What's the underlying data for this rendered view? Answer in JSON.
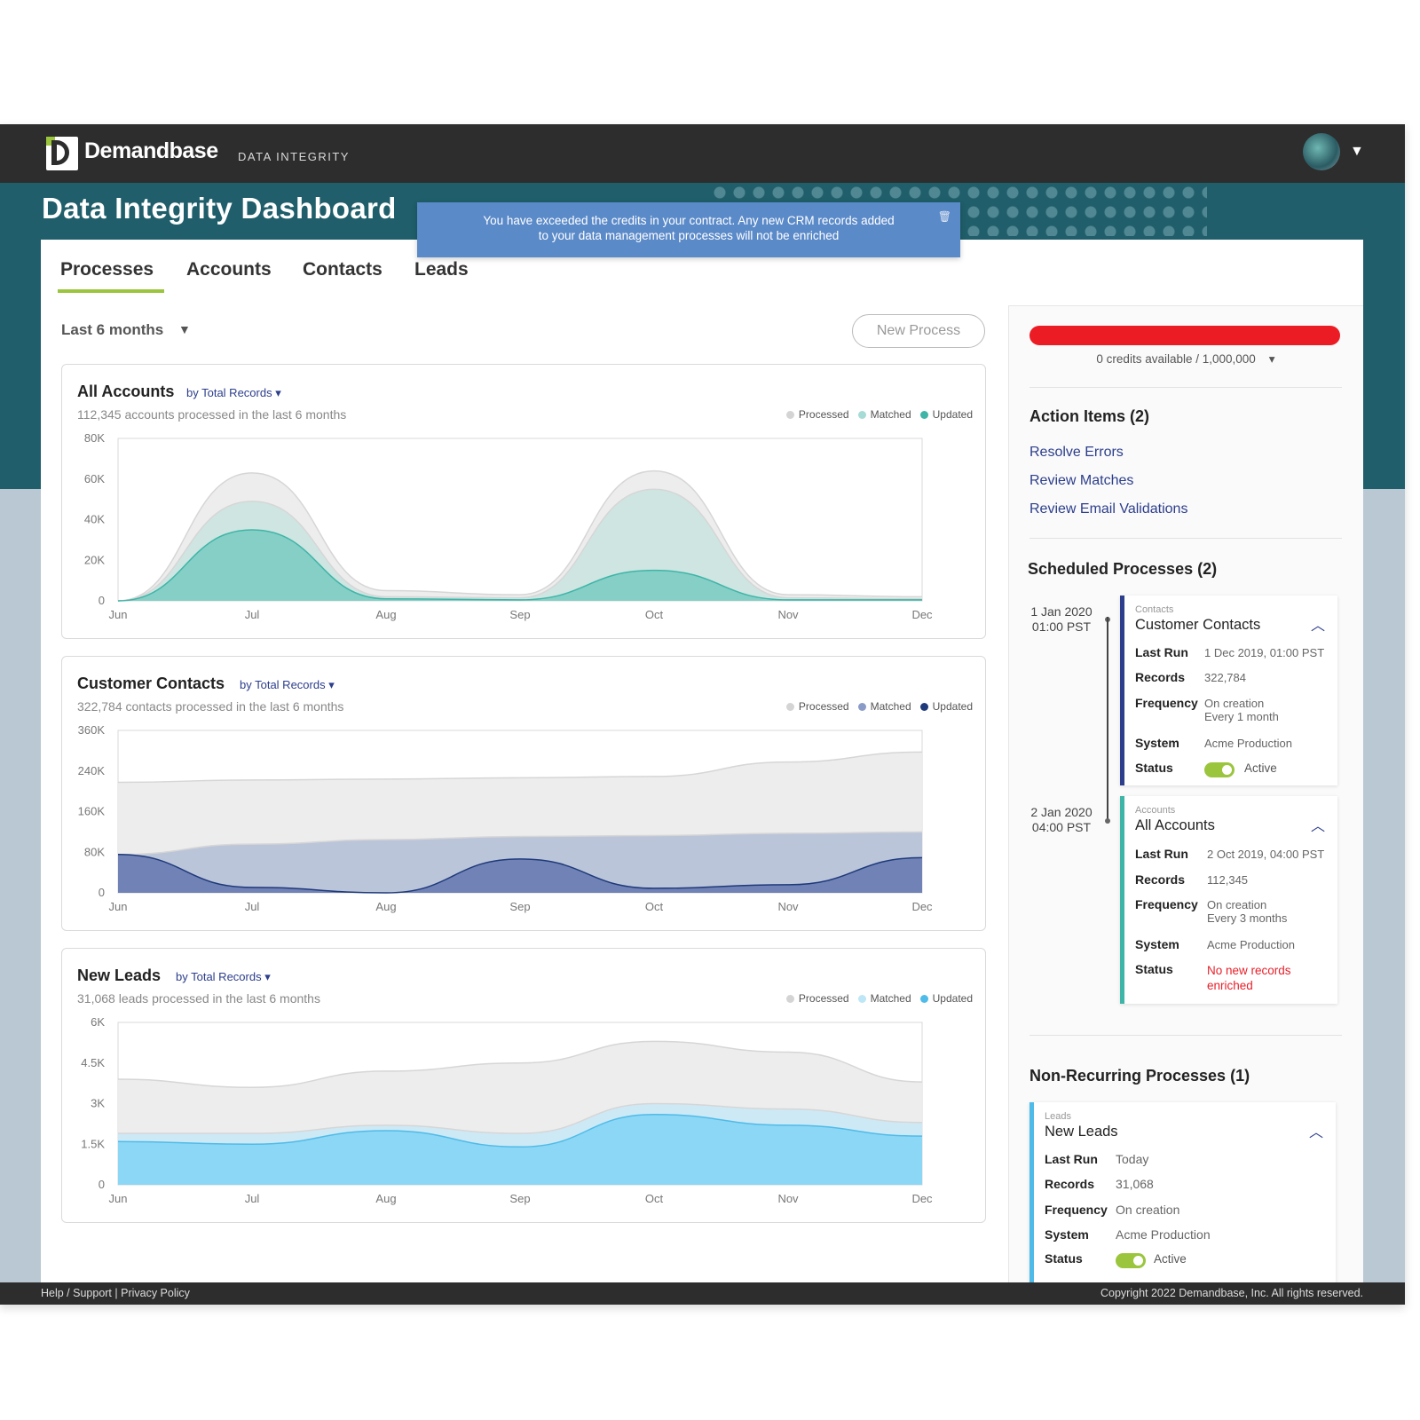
{
  "topbar": {
    "brand": "Demandbase",
    "product": "DATA INTEGRITY"
  },
  "page_title": "Data Integrity Dashboard",
  "toast": {
    "message_line1": "You have exceeded the credits in your contract. Any new CRM records added",
    "message_line2": "to your data management processes will not be enriched"
  },
  "tabs": [
    {
      "label": "Processes",
      "active": true
    },
    {
      "label": "Accounts"
    },
    {
      "label": "Contacts"
    },
    {
      "label": "Leads"
    }
  ],
  "filters": {
    "range": "Last 6 months",
    "new_process": "New Process"
  },
  "legend_labels": {
    "processed": "Processed",
    "matched": "Matched",
    "updated": "Updated"
  },
  "charts_meta": [
    {
      "title": "All Accounts",
      "by": "by Total Records",
      "sub": "112,345 accounts processed in the last 6 months"
    },
    {
      "title": "Customer Contacts",
      "by": "by Total Records",
      "sub": "322,784 contacts processed in the last 6 months"
    },
    {
      "title": "New Leads",
      "by": "by Total Records",
      "sub": "31,068 leads processed in the last 6 months"
    }
  ],
  "chart_data": [
    {
      "type": "area",
      "title": "All Accounts",
      "x": [
        "Jun",
        "Jul",
        "Aug",
        "Sep",
        "Oct",
        "Nov",
        "Dec"
      ],
      "yticks": [
        "0",
        "20K",
        "40K",
        "60K",
        "80K"
      ],
      "ylim": [
        0,
        80000
      ],
      "colors": [
        "#ececec",
        "#cce5e2",
        "#82cdc4"
      ],
      "stroke": "#3fb5a7",
      "series": [
        {
          "name": "Processed",
          "values": [
            0,
            63000,
            5000,
            3000,
            64000,
            3000,
            2000
          ]
        },
        {
          "name": "Matched",
          "values": [
            0,
            49000,
            2000,
            1500,
            55000,
            1500,
            1000
          ]
        },
        {
          "name": "Updated",
          "values": [
            0,
            35000,
            1000,
            500,
            15000,
            500,
            500
          ]
        }
      ]
    },
    {
      "type": "area",
      "title": "Customer Contacts",
      "x": [
        "Jun",
        "Jul",
        "Aug",
        "Sep",
        "Oct",
        "Nov",
        "Dec"
      ],
      "yticks": [
        "0",
        "80K",
        "160K",
        "240K",
        "360K"
      ],
      "ylim": [
        0,
        360000
      ],
      "colors": [
        "#ececec",
        "#b8c3d9",
        "#6d80b4"
      ],
      "stroke": "#1f3a7a",
      "series": [
        {
          "name": "Processed",
          "values": [
            245000,
            250000,
            252000,
            255000,
            258000,
            290000,
            312000
          ]
        },
        {
          "name": "Matched",
          "values": [
            85000,
            108000,
            118000,
            125000,
            127000,
            132000,
            135000
          ]
        },
        {
          "name": "Updated",
          "values": [
            85000,
            12000,
            0,
            75000,
            10000,
            18000,
            78000
          ]
        }
      ]
    },
    {
      "type": "area",
      "title": "New Leads",
      "x": [
        "Jun",
        "Jul",
        "Aug",
        "Sep",
        "Oct",
        "Nov",
        "Dec"
      ],
      "yticks": [
        "0",
        "1.5K",
        "3K",
        "4.5K",
        "6K"
      ],
      "ylim": [
        0,
        6000
      ],
      "colors": [
        "#ececec",
        "#cbe9f7",
        "#88d6f5"
      ],
      "stroke": "#4fbbe8",
      "series": [
        {
          "name": "Processed",
          "values": [
            3900,
            3600,
            4200,
            4500,
            5300,
            4900,
            3800
          ]
        },
        {
          "name": "Matched",
          "values": [
            1900,
            1900,
            2200,
            1900,
            3000,
            2800,
            2300
          ]
        },
        {
          "name": "Updated",
          "values": [
            1600,
            1500,
            2000,
            1400,
            2600,
            2200,
            1800
          ]
        }
      ]
    }
  ],
  "credits": {
    "text": "0 credits available / 1,000,000",
    "fraction_used": 1.0,
    "color": "#ec1c24"
  },
  "action_items": {
    "title": "Action Items (2)",
    "links": [
      "Resolve Errors",
      "Review Matches",
      "Review Email Validations"
    ]
  },
  "scheduled": {
    "title": "Scheduled Processes (2)",
    "items": [
      {
        "date": "1 Jan 2020",
        "time": "01:00 PST",
        "type": "Contacts",
        "name": "Customer Contacts",
        "last_run_label": "Last Run",
        "last_run": "1 Dec 2019, 01:00 PST",
        "records_label": "Records",
        "records": "322,784",
        "frequency_label": "Frequency",
        "frequency1": "On creation",
        "frequency2": "Every 1 month",
        "system_label": "System",
        "system": "Acme Production",
        "status_label": "Status",
        "status": "Active"
      },
      {
        "date": "2 Jan 2020",
        "time": "04:00 PST",
        "type": "Accounts",
        "name": "All Accounts",
        "last_run_label": "Last Run",
        "last_run": "2 Oct 2019, 04:00 PST",
        "records_label": "Records",
        "records": "112,345",
        "frequency_label": "Frequency",
        "frequency1": "On creation",
        "frequency2": "Every 3 months",
        "system_label": "System",
        "system": "Acme Production",
        "status_label": "Status",
        "status1": "No new records",
        "status2": "enriched"
      }
    ]
  },
  "non_recurring": {
    "title": "Non-Recurring Processes (1)",
    "item": {
      "type": "Leads",
      "name": "New Leads",
      "last_run_label": "Last Run",
      "last_run": "Today",
      "records_label": "Records",
      "records": "31,068",
      "frequency_label": "Frequency",
      "frequency": "On creation",
      "system_label": "System",
      "system": "Acme Production",
      "status_label": "Status",
      "status": "Active"
    }
  },
  "footer": {
    "links": "Help / Support | Privacy Policy",
    "copyright": "Copyright 2022 Demandbase, Inc. All rights reserved."
  }
}
